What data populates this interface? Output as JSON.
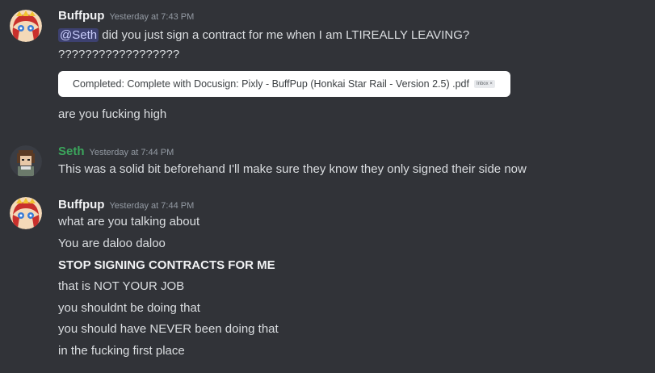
{
  "messages": [
    {
      "username": "Buffpup",
      "timestamp": "Yesterday at 7:43 PM",
      "mention": "@Seth",
      "first_line_rest": " did you just sign a contract for me when I am LTIREALLY LEAVING?",
      "line2": "??????????????????",
      "embed": {
        "title": "Completed: Complete with Docusign: Pixly - BuffPup (Honkai Star Rail - Version 2.5) .pdf",
        "tag": "Inbox ×"
      },
      "line3": "are you fucking high"
    },
    {
      "username": "Seth",
      "timestamp": "Yesterday at 7:44 PM",
      "line1": "This was a solid bit beforehand I'll make sure they know they only signed their side now"
    },
    {
      "username": "Buffpup",
      "timestamp": "Yesterday at 7:44 PM",
      "lines": [
        "what are you talking about",
        "You are daloo daloo",
        "STOP SIGNING CONTRACTS FOR ME",
        "that is NOT YOUR JOB",
        "you shouldnt be doing that",
        "you should have NEVER been doing that",
        "in the fucking first place"
      ]
    }
  ],
  "colors": {
    "background": "#313338",
    "username_buffpup": "#f2f3f5",
    "username_seth": "#3ba55c",
    "mention_bg": "#5865f24d"
  },
  "icons": {
    "buffpup_avatar": "anime-avatar-icon",
    "seth_avatar": "pixel-avatar-icon"
  }
}
